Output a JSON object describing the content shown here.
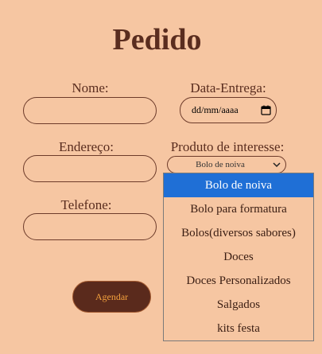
{
  "title": "Pedido",
  "form": {
    "nome_label": "Nome:",
    "data_label": "Data-Entrega:",
    "data_placeholder": "dd/mm/aaaa",
    "endereco_label": "Endereço:",
    "produto_label": "Produto de interesse:",
    "produto_selected": "Bolo de noiva",
    "telefone_label": "Telefone:",
    "submit_label": "Agendar"
  },
  "dropdown": {
    "options": [
      "Bolo de noiva",
      "Bolo para formatura",
      "Bolos(diversos sabores)",
      "Doces",
      "Doces Personalizados",
      "Salgados",
      "kits festa"
    ],
    "highlighted": "Bolo de noiva"
  },
  "colors": {
    "background": "#f6c6a2",
    "text": "#5a2d1f",
    "button_bg": "#5a2a1c",
    "button_text": "#f2a03d",
    "highlight": "#1f6fd6"
  }
}
